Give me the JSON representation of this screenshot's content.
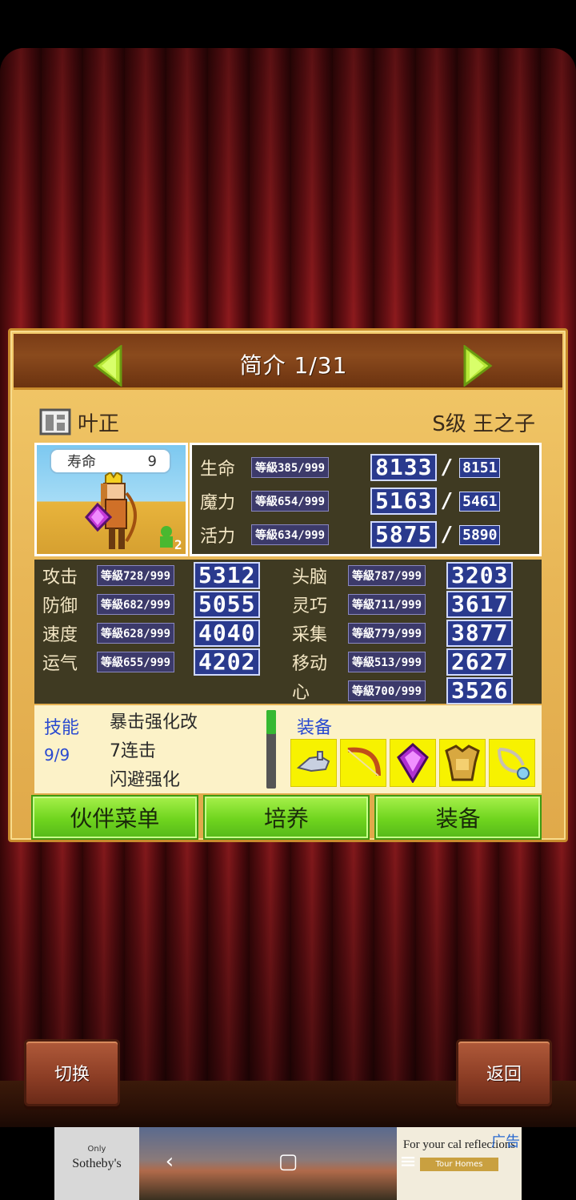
{
  "header": {
    "title": "简介 1/31",
    "prev_label": "◀",
    "next_label": "▶"
  },
  "character": {
    "name": "叶正",
    "rank_job": "S级 王之子",
    "life_label": "寿命",
    "life_value": "9",
    "party_count": "2"
  },
  "top_stats": [
    {
      "label": "生命",
      "level": "等級385/999",
      "value": "8133",
      "max": "8151"
    },
    {
      "label": "魔力",
      "level": "等級654/999",
      "value": "5163",
      "max": "5461"
    },
    {
      "label": "活力",
      "level": "等級634/999",
      "value": "5875",
      "max": "5890"
    }
  ],
  "left_stats": [
    {
      "label": "攻击",
      "level": "等級728/999",
      "value": "5312"
    },
    {
      "label": "防御",
      "level": "等級682/999",
      "value": "5055"
    },
    {
      "label": "速度",
      "level": "等級628/999",
      "value": "4040"
    },
    {
      "label": "运气",
      "level": "等級655/999",
      "value": "4202"
    }
  ],
  "right_stats": [
    {
      "label": "头脑",
      "level": "等級787/999",
      "value": "3203"
    },
    {
      "label": "灵巧",
      "level": "等級711/999",
      "value": "3617"
    },
    {
      "label": "采集",
      "level": "等級779/999",
      "value": "3877"
    },
    {
      "label": "移动",
      "level": "等級513/999",
      "value": "2627"
    },
    {
      "label": "心",
      "level": "等級700/999",
      "value": "3526"
    }
  ],
  "skills": {
    "title": "技能",
    "count": "9/9",
    "items": [
      "暴击强化改",
      "7连击",
      "闪避强化"
    ]
  },
  "equipment": {
    "title": "装备",
    "slots": [
      "gauntlet-icon",
      "bow-icon",
      "gem-icon",
      "armor-icon",
      "necklace-icon"
    ]
  },
  "buttons": {
    "party_menu": "伙伴菜单",
    "train": "培养",
    "equip": "装备",
    "switch": "切换",
    "back": "返回"
  },
  "ad": {
    "left_small": "Only",
    "left_brand": "Sotheby's",
    "right_text": "For your cal reflections",
    "right_cta": "Tour Homes",
    "tag": "广告"
  },
  "colors": {
    "panel": "#e8b656",
    "header_wood": "#7a3c16",
    "stat_bg": "#3f3a22",
    "number_blue": "#2a3a8e",
    "green_button": "#6fd41e",
    "equip_yellow": "#f7f200"
  }
}
